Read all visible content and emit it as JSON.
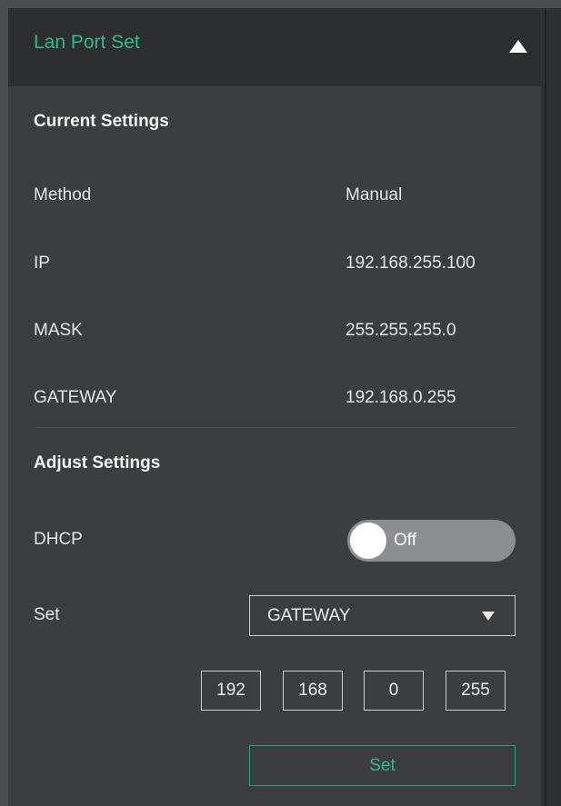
{
  "header": {
    "title": "Lan Port Set",
    "collapse_icon": "triangle-up-icon"
  },
  "current": {
    "title": "Current Settings",
    "rows": [
      {
        "label": "Method",
        "value": "Manual"
      },
      {
        "label": "IP",
        "value": "192.168.255.100"
      },
      {
        "label": "MASK",
        "value": "255.255.255.0"
      },
      {
        "label": "GATEWAY",
        "value": "192.168.0.255"
      }
    ]
  },
  "adjust": {
    "title": "Adjust Settings",
    "dhcp": {
      "label": "DHCP",
      "state": "Off"
    },
    "set": {
      "label": "Set",
      "selected": "GATEWAY",
      "dropdown_icon": "triangle-down-icon"
    },
    "octets": [
      "192",
      "168",
      "0",
      "255"
    ],
    "button_label": "Set"
  },
  "colors": {
    "accent": "#34b88a",
    "panel_bg": "#3b3d3f",
    "header_bg": "#2c2e30",
    "toggle_off_bg": "#8c8e91"
  }
}
